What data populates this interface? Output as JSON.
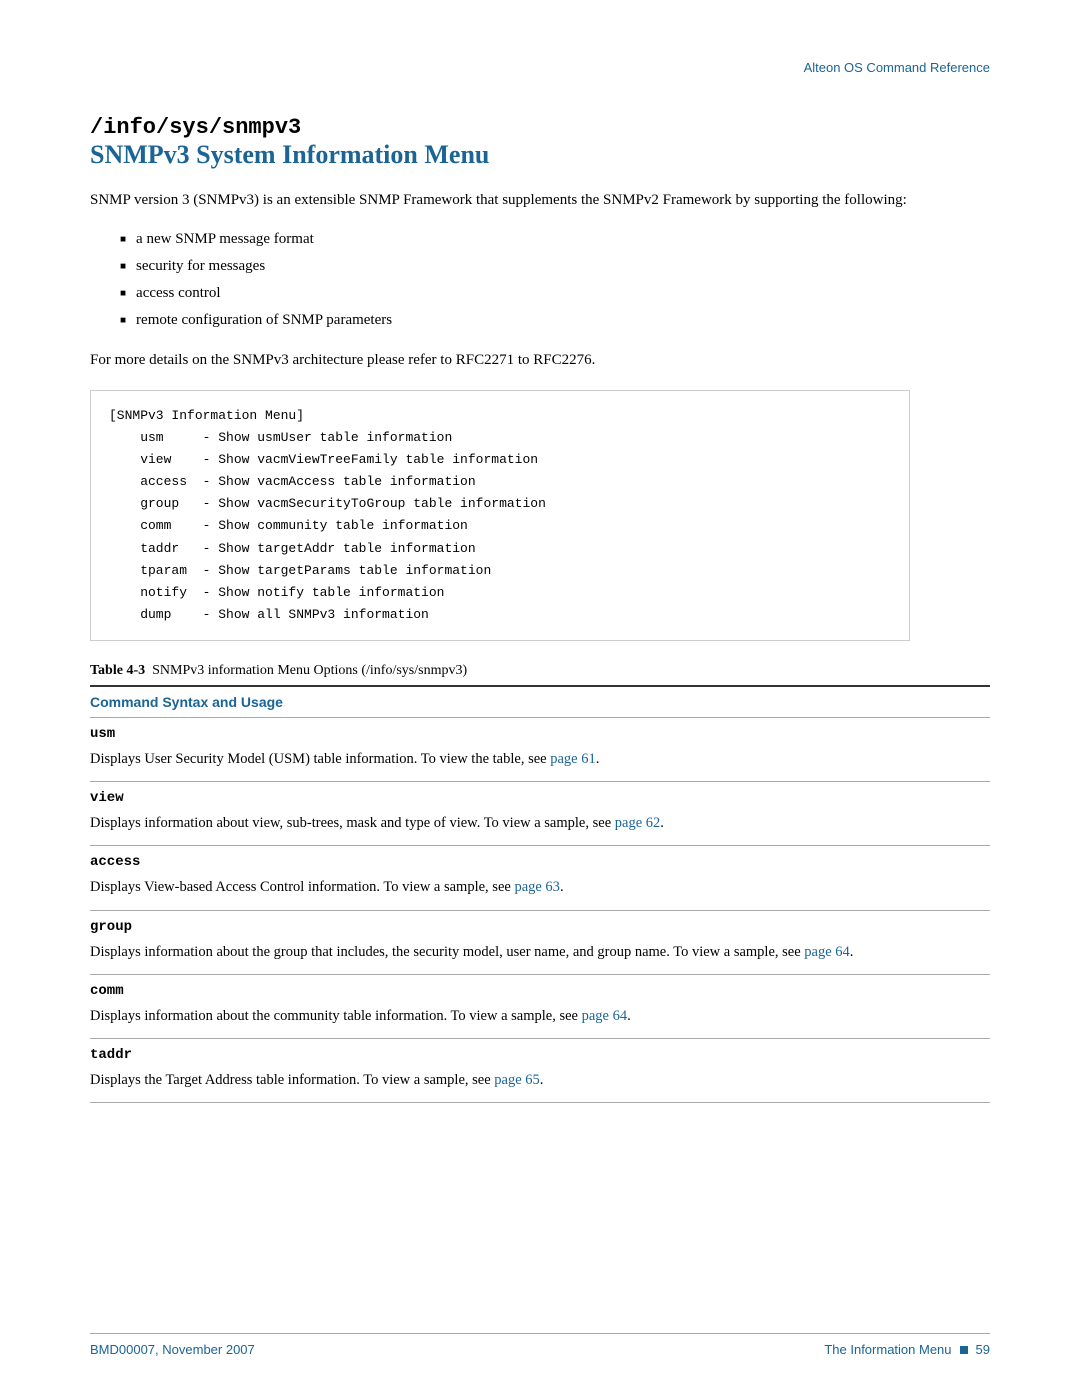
{
  "header": {
    "title": "Alteon OS  Command Reference"
  },
  "section": {
    "code_title": "/info/sys/snmpv3",
    "text_title": "SNMPv3 System Information Menu",
    "intro_para1": "SNMP version 3 (SNMPv3) is an extensible SNMP Framework that supplements the SNMPv2 Framework by supporting the following:",
    "bullets": [
      "a new SNMP message format",
      "security for messages",
      "access control",
      "remote configuration of SNMP parameters"
    ],
    "ref_para": "For more details on the SNMPv3 architecture please refer to RFC2271 to RFC2276.",
    "code_block": "[SNMPv3 Information Menu]\n    usm     - Show usmUser table information\n    view    - Show vacmViewTreeFamily table information\n    access  - Show vacmAccess table information\n    group   - Show vacmSecurityToGroup table information\n    comm    - Show community table information\n    taddr   - Show targetAddr table information\n    tparam  - Show targetParams table information\n    notify  - Show notify table information\n    dump    - Show all SNMPv3 information",
    "table_caption": "Table 4-3  SNMPv3 information Menu Options (/info/sys/snmpv3)",
    "cmd_syntax_label": "Command Syntax and Usage",
    "commands": [
      {
        "name": "usm",
        "desc": "Displays User Security Model (USM) table information. To view the table, see ",
        "link_text": "page 61",
        "link_ref": "#"
      },
      {
        "name": "view",
        "desc": "Displays information about view, sub-trees, mask and type of view. To view a sample, see ",
        "link_text": "page 62",
        "link_ref": "#"
      },
      {
        "name": "access",
        "desc": "Displays View-based Access Control information. To view a sample, see ",
        "link_text": "page 63",
        "link_ref": "#"
      },
      {
        "name": "group",
        "desc": "Displays information about the group that includes, the security model, user name, and group name. To view a sample, see ",
        "link_text": "page 64",
        "link_ref": "#"
      },
      {
        "name": "comm",
        "desc": "Displays information about the community table information. To view a sample, see ",
        "link_text": "page 64",
        "link_ref": "#"
      },
      {
        "name": "taddr",
        "desc": "Displays the Target Address table information. To view a sample, see ",
        "link_text": "page 65",
        "link_ref": "#"
      }
    ]
  },
  "footer": {
    "left": "BMD00007, November 2007",
    "right_text": "The Information Menu",
    "page_number": "59"
  }
}
